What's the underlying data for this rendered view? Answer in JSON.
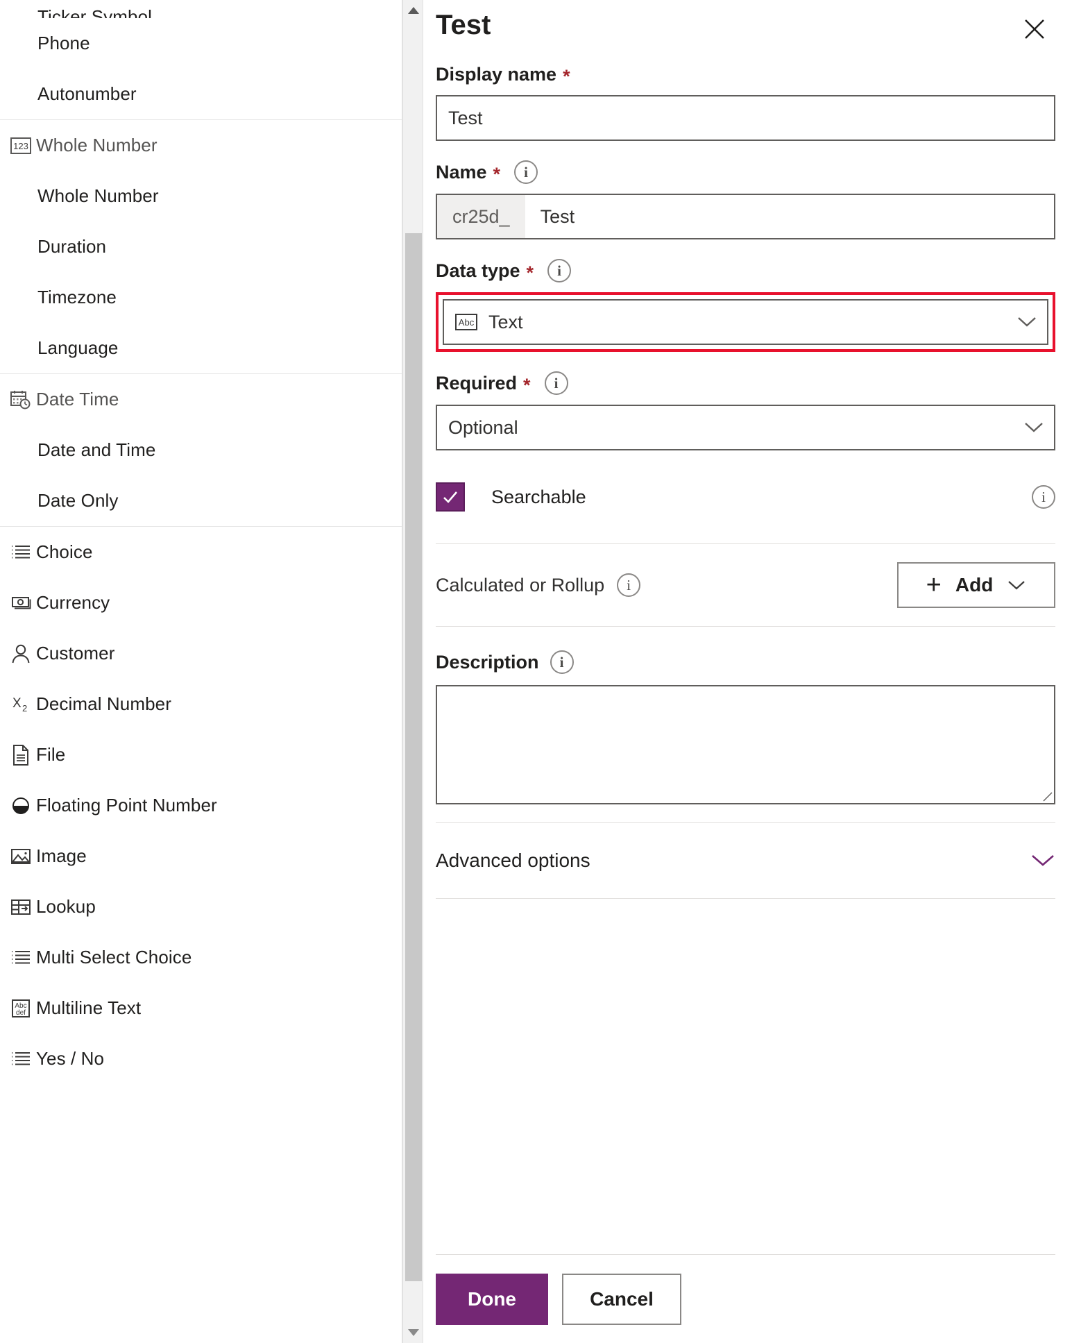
{
  "type_list": {
    "groups": [
      {
        "header": null,
        "items": [
          {
            "label": "Ticker Symbol",
            "icon": null,
            "level": "child",
            "clipped": true
          },
          {
            "label": "Phone",
            "icon": null,
            "level": "child",
            "clipped": false
          },
          {
            "label": "Autonumber",
            "icon": null,
            "level": "child",
            "clipped": false
          }
        ]
      },
      {
        "header": {
          "label": "Whole Number",
          "icon": "123-number-icon"
        },
        "items": [
          {
            "label": "Whole Number",
            "icon": null,
            "level": "child",
            "clipped": false
          },
          {
            "label": "Duration",
            "icon": null,
            "level": "child",
            "clipped": false
          },
          {
            "label": "Timezone",
            "icon": null,
            "level": "child",
            "clipped": false
          },
          {
            "label": "Language",
            "icon": null,
            "level": "child",
            "clipped": false
          }
        ]
      },
      {
        "header": {
          "label": "Date Time",
          "icon": "calendar-clock-icon"
        },
        "items": [
          {
            "label": "Date and Time",
            "icon": null,
            "level": "child",
            "clipped": false
          },
          {
            "label": "Date Only",
            "icon": null,
            "level": "child",
            "clipped": false
          }
        ]
      },
      {
        "header": null,
        "items": [
          {
            "label": "Choice",
            "icon": "list-icon",
            "level": "top",
            "clipped": false
          },
          {
            "label": "Currency",
            "icon": "currency-icon",
            "level": "top",
            "clipped": false
          },
          {
            "label": "Customer",
            "icon": "person-icon",
            "level": "top",
            "clipped": false
          },
          {
            "label": "Decimal Number",
            "icon": "subscript-x2-icon",
            "level": "top",
            "clipped": false
          },
          {
            "label": "File",
            "icon": "file-icon",
            "level": "top",
            "clipped": false
          },
          {
            "label": "Floating Point Number",
            "icon": "half-circle-icon",
            "level": "top",
            "clipped": false
          },
          {
            "label": "Image",
            "icon": "image-icon",
            "level": "top",
            "clipped": false
          },
          {
            "label": "Lookup",
            "icon": "lookup-icon",
            "level": "top",
            "clipped": false
          },
          {
            "label": "Multi Select Choice",
            "icon": "list-icon",
            "level": "top",
            "clipped": false
          },
          {
            "label": "Multiline Text",
            "icon": "abc-def-icon",
            "level": "top",
            "clipped": false
          },
          {
            "label": "Yes / No",
            "icon": "list-icon",
            "level": "top",
            "clipped": false
          }
        ]
      }
    ]
  },
  "scrollbar": {
    "up_arrow_icon": "chevron-up-icon",
    "down_arrow_icon": "chevron-down-icon",
    "thumb_icon": "scroll-thumb"
  },
  "panel": {
    "title": "Test",
    "close_icon": "close-icon",
    "display_name": {
      "label": "Display name",
      "required_marker": "*",
      "value": "Test"
    },
    "name": {
      "label": "Name",
      "required_marker": "*",
      "info_icon": "info-icon",
      "prefix": "cr25d_",
      "value": "Test"
    },
    "data_type": {
      "label": "Data type",
      "required_marker": "*",
      "info_icon": "info-icon",
      "value": "Text",
      "value_icon": "abc-text-icon",
      "chevron_icon": "chevron-down-icon",
      "highlight_color": "#e8112d"
    },
    "required_field": {
      "label": "Required",
      "required_marker": "*",
      "info_icon": "info-icon",
      "value": "Optional",
      "chevron_icon": "chevron-down-icon"
    },
    "searchable": {
      "label": "Searchable",
      "checked": true,
      "check_icon": "checkmark-icon",
      "info_icon": "info-icon",
      "accent_color": "#742774"
    },
    "calculated_or_rollup": {
      "label": "Calculated or Rollup",
      "info_icon": "info-icon",
      "add_label": "Add",
      "plus_icon": "plus-icon",
      "chevron_icon": "chevron-down-icon"
    },
    "description": {
      "label": "Description",
      "info_icon": "info-icon",
      "value": "",
      "resize_icon": "resize-grip-icon"
    },
    "advanced_options": {
      "label": "Advanced options",
      "chevron_icon": "chevron-down-icon",
      "accent_color": "#742774"
    },
    "footer": {
      "done_label": "Done",
      "cancel_label": "Cancel",
      "primary_color": "#742774"
    }
  }
}
